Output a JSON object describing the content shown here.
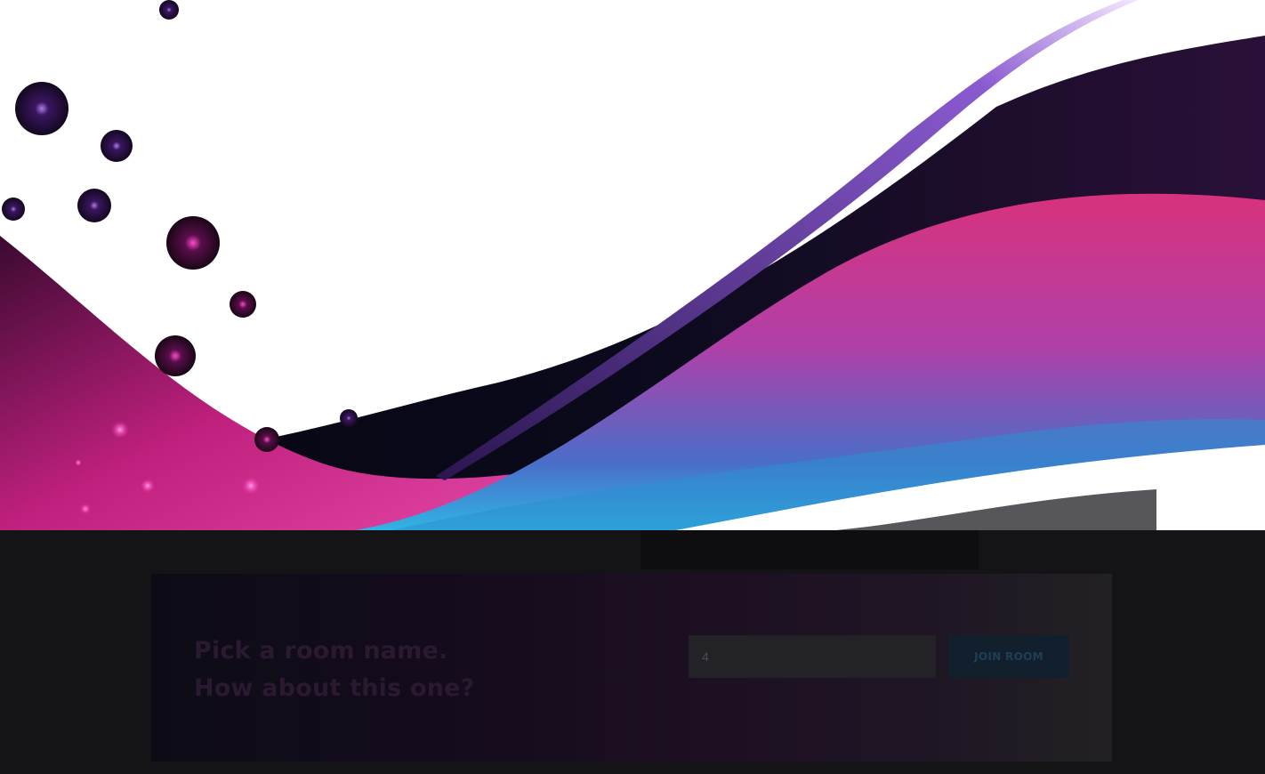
{
  "room_picker": {
    "prompt_line_1": "Pick a room name.",
    "prompt_line_2": "How about this one?",
    "room_input_value": "4",
    "join_button_label": "JOIN ROOM"
  },
  "colors": {
    "page_background": "#141416",
    "hero_background": "#ffffff",
    "wave_magenta": "#d62c9b",
    "wave_blue": "#3aa9d8",
    "wave_dark": "#0a0916",
    "card_background": "#160d1d",
    "input_background": "#232226",
    "button_background": "#12202e"
  },
  "icons": {
    "hero_artwork": "abstract-wave-bubbles"
  }
}
